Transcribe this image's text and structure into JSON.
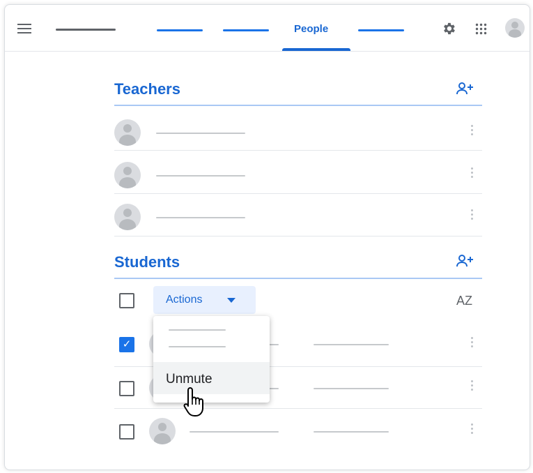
{
  "topbar": {
    "active_tab": "People"
  },
  "sections": {
    "teachers": {
      "title": "Teachers"
    },
    "students": {
      "title": "Students"
    }
  },
  "students_toolbar": {
    "actions_label": "Actions",
    "sort_label": "AZ"
  },
  "actions_menu": {
    "items": [
      {
        "label": "Unmute"
      }
    ]
  },
  "students": [
    {
      "checked": true
    },
    {
      "checked": false
    },
    {
      "checked": false
    }
  ],
  "colors": {
    "accent": "#1967d2",
    "section_rule": "#a9c8f4",
    "action_bg": "#e8f0fe"
  }
}
